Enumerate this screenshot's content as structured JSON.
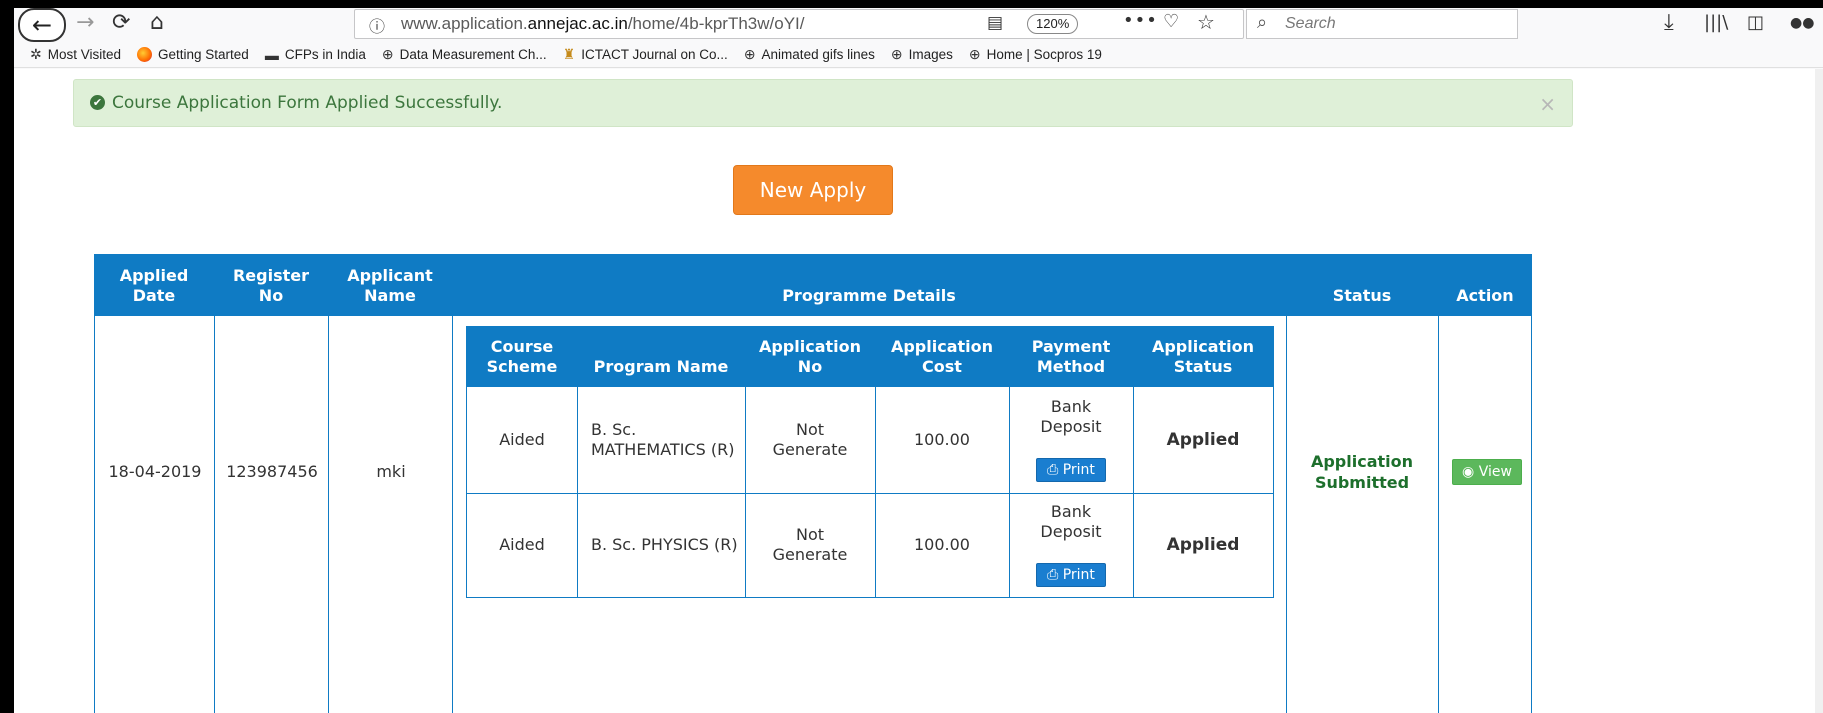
{
  "browser": {
    "url_prefix": "www.application.",
    "url_domain": "annejac.ac.in",
    "url_path": "/home/4b-kprTh3w/oYI/",
    "zoom": "120%",
    "search_placeholder": "Search"
  },
  "bookmarks": [
    {
      "label": "Most Visited",
      "icon": "gear-icon"
    },
    {
      "label": "Getting Started",
      "icon": "firefox-icon"
    },
    {
      "label": "CFPs in India",
      "icon": "bus-icon"
    },
    {
      "label": "Data Measurement Ch...",
      "icon": "globe-icon"
    },
    {
      "label": "ICTACT Journal on Co...",
      "icon": "site-icon"
    },
    {
      "label": "Animated gifs lines",
      "icon": "globe-icon"
    },
    {
      "label": "Images",
      "icon": "globe-icon"
    },
    {
      "label": "Home | Socpros 19",
      "icon": "globe-icon"
    }
  ],
  "alert": {
    "message": "Course Application Form Applied Successfully.",
    "close": "×"
  },
  "new_apply_label": "New Apply",
  "outer_table": {
    "headers": {
      "applied_date": [
        "Applied",
        "Date"
      ],
      "register_no": [
        "Register",
        "No"
      ],
      "applicant_name": [
        "Applicant",
        "Name"
      ],
      "programme_details": "Programme Details",
      "status": "Status",
      "action": "Action"
    },
    "row": {
      "applied_date": "18-04-2019",
      "register_no": "123987456",
      "applicant_name": "mki",
      "status": [
        "Application",
        "Submitted"
      ],
      "action_label": "View"
    }
  },
  "inner_table": {
    "headers": {
      "course_scheme": [
        "Course",
        "Scheme"
      ],
      "program_name": "Program Name",
      "application_no": [
        "Application",
        "No"
      ],
      "application_cost": [
        "Application",
        "Cost"
      ],
      "payment_method": [
        "Payment",
        "Method"
      ],
      "application_status": [
        "Application",
        "Status"
      ]
    },
    "rows": [
      {
        "course_scheme": "Aided",
        "program_name": [
          "B. Sc.",
          "MATHEMATICS (R)"
        ],
        "application_no": [
          "Not",
          "Generate"
        ],
        "application_cost": "100.00",
        "payment_method": [
          "Bank",
          "Deposit"
        ],
        "print_label": "Print",
        "application_status": "Applied"
      },
      {
        "course_scheme": "Aided",
        "program_name": [
          "B. Sc. PHYSICS (R)"
        ],
        "application_no": [
          "Not",
          "Generate"
        ],
        "application_cost": "100.00",
        "payment_method": [
          "Bank",
          "Deposit"
        ],
        "print_label": "Print",
        "application_status": "Applied"
      }
    ]
  }
}
